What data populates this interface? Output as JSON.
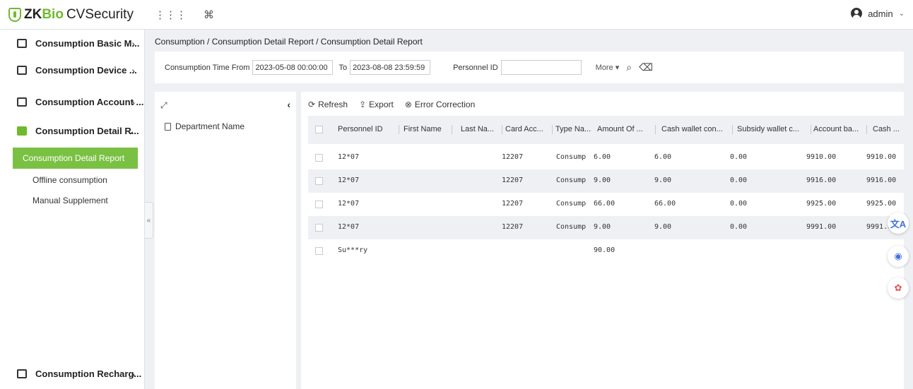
{
  "app": {
    "brand_zk": "ZK",
    "brand_bio": "Bio",
    "brand_cv": "CVSecurity",
    "user": "admin"
  },
  "colors": {
    "accent": "#7ac143",
    "brand_green": "#6fba2c"
  },
  "sidebar": {
    "groups": [
      {
        "label": "Consumption Basic M...",
        "icon": "card-reader-icon"
      },
      {
        "label": "Consumption Device ...",
        "icon": "device-icon"
      },
      {
        "label": "Consumption Account ...",
        "icon": "account-icon"
      },
      {
        "label": "Consumption Detail R...",
        "icon": "chart-icon"
      },
      {
        "label": "Consumption Recharg...",
        "icon": "recharge-icon"
      }
    ],
    "subitems": [
      "Consumption Detail Report",
      "Offline consumption",
      "Manual Supplement"
    ]
  },
  "breadcrumb": "Consumption / Consumption Detail Report / Consumption Detail Report",
  "filter": {
    "time_from_label": "Consumption Time From",
    "time_from": "2023-05-08 00:00:00",
    "to_label": "To",
    "time_to": "2023-08-08 23:59:59",
    "personnel_label": "Personnel ID",
    "personnel_value": "",
    "more_label": "More"
  },
  "tree": {
    "department_label": "Department Name"
  },
  "toolbar": {
    "refresh": "Refresh",
    "export": "Export",
    "error_correction": "Error Correction"
  },
  "table": {
    "headers": [
      "Personnel ID",
      "First Name",
      "Last Na...",
      "Card Acc...",
      "Type Na...",
      "Amount Of ...",
      "Cash wallet con...",
      "Subsidy wallet c...",
      "Account ba...",
      "Cash ..."
    ],
    "rows": [
      {
        "id": "12*07",
        "first": "",
        "last": "",
        "card": "12207",
        "type": "Consump",
        "amount": "6.00",
        "cash_wallet": "6.00",
        "subsidy": "0.00",
        "balance": "9910.00",
        "cash": "9910.00"
      },
      {
        "id": "12*07",
        "first": "",
        "last": "",
        "card": "12207",
        "type": "Consump",
        "amount": "9.00",
        "cash_wallet": "9.00",
        "subsidy": "0.00",
        "balance": "9916.00",
        "cash": "9916.00"
      },
      {
        "id": "12*07",
        "first": "",
        "last": "",
        "card": "12207",
        "type": "Consump",
        "amount": "66.00",
        "cash_wallet": "66.00",
        "subsidy": "0.00",
        "balance": "9925.00",
        "cash": "9925.00"
      },
      {
        "id": "12*07",
        "first": "",
        "last": "",
        "card": "12207",
        "type": "Consump",
        "amount": "9.00",
        "cash_wallet": "9.00",
        "subsidy": "0.00",
        "balance": "9991.00",
        "cash": "9991.0"
      }
    ],
    "summary": {
      "label": "Su***ry",
      "amount": "90.00"
    }
  }
}
